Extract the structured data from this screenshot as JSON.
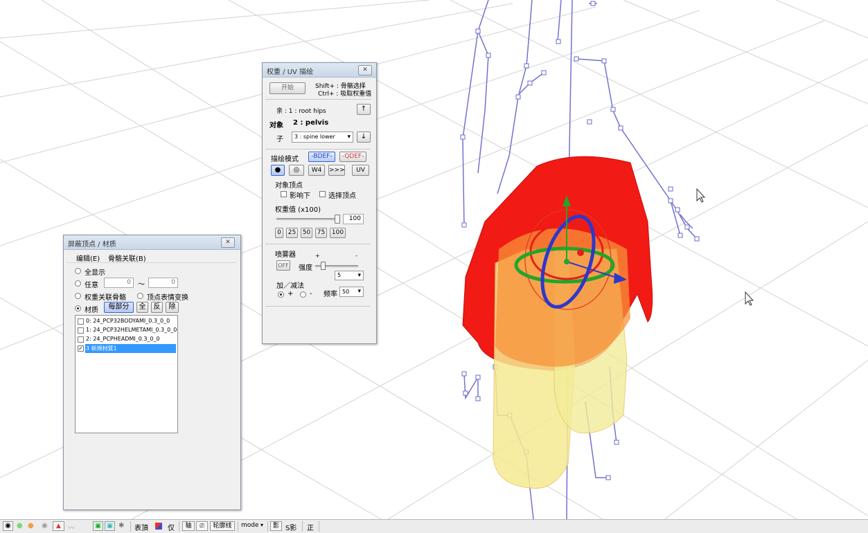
{
  "weight_window": {
    "title": "权重 / UV 描绘",
    "start_label": "开始",
    "hint_shift": "Shift+ : 骨骼选择",
    "hint_ctrl": "Ctrl+ : 吸取权重值",
    "parent_label": "亲 : 1 : root hips",
    "target_label": "对象",
    "target_value": "2 : pelvis",
    "child_label": "子",
    "child_value": "3 : spine lower",
    "up_arrow": "↑",
    "down_arrow": "↓",
    "paint_mode_label": "描绘模式",
    "bdef_label": "-BDEF-",
    "qdef_label": "-QDEF-",
    "brush_round_glyph": "●",
    "brush_ring_glyph": "◎",
    "w4_label": "W4",
    "arrows_label": ">>>",
    "uv_label": "UV",
    "target_vertex_label": "对象顶点",
    "affect_below_label": "影响下",
    "selected_vertex_label": "选择顶点",
    "weight_value_label": "权重值 (x100)",
    "weight_value": "100",
    "presets": [
      "0",
      "25",
      "50",
      "75",
      "100"
    ],
    "sprayer_label": "喷雾器",
    "plus_mark": "+",
    "minus_mark": "-",
    "off_label": "OFF",
    "strength_label": "强度",
    "strength_value": "5",
    "add_sub_label": "加／减法",
    "add_label": "+",
    "sub_label": "-",
    "frequency_label": "频率",
    "frequency_value": "50"
  },
  "mask_window": {
    "title": "屏蔽顶点 / 材质",
    "menu": [
      "编辑(E)",
      "骨骼关联(B)"
    ],
    "show_all_label": "全显示",
    "any_label": "任意",
    "range_from": "0",
    "range_sep": "〜",
    "range_to": "0",
    "weight_bone_label": "权重关联骨骼",
    "vertex_morph_label": "顶点表情变换",
    "material_label": "材质",
    "each_part_label": "每部分",
    "all_label": "全",
    "invert_label": "反",
    "remove_label": "除",
    "materials": [
      {
        "label": "0: 24_PCP32BODYAMI_0.3_0_0",
        "checked": false,
        "selected": false
      },
      {
        "label": "1: 24_PCP32HELMETAMI_0.3_0_0",
        "checked": false,
        "selected": false
      },
      {
        "label": "2: 24_PCPHEADMI_0.3_0_0",
        "checked": false,
        "selected": false
      },
      {
        "label": "3  新規材質1",
        "checked": true,
        "selected": true
      }
    ]
  },
  "status_bar": {
    "surface_label": "表頂",
    "only_label": "仅",
    "axis_label": "轴",
    "outline_label": "轮廓线",
    "mode_label": "mode",
    "shadow_label": "影",
    "s_shadow_label": "S影",
    "front_label": "正",
    "colors": {
      "red": "#e83232",
      "blue": "#3150d8",
      "green": "#22a52b"
    }
  },
  "viewport": {
    "colors": {
      "grid": "#cfcfcf",
      "bone": "#7070d0",
      "mesh_red": "#f01818",
      "mesh_orange": "#f59a3a",
      "mesh_yellow": "#f3ec9a"
    }
  }
}
